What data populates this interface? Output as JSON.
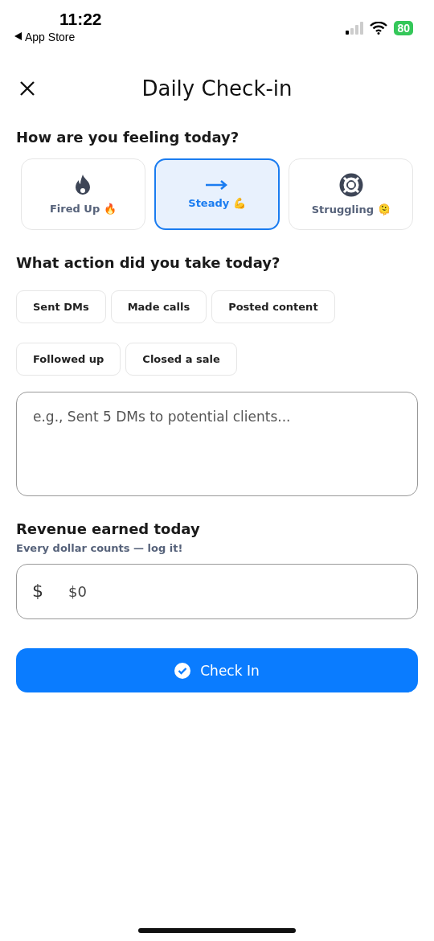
{
  "status_bar": {
    "time": "11:22",
    "back_label": "App Store",
    "battery": "80"
  },
  "header": {
    "title": "Daily Check-in"
  },
  "mood": {
    "question": "How are you feeling today?",
    "options": [
      {
        "kind": "fire",
        "label": "Fired Up 🔥",
        "selected": false
      },
      {
        "kind": "arrow",
        "label": "Steady 💪",
        "selected": true
      },
      {
        "kind": "lifebuoy",
        "label": "Struggling 🫠",
        "selected": false
      }
    ]
  },
  "actions": {
    "question": "What action did you take today?",
    "rows": [
      [
        {
          "label": "Sent DMs",
          "selected": false
        },
        {
          "label": "Made calls",
          "selected": false
        },
        {
          "label": "Posted content",
          "selected": false
        }
      ],
      [
        {
          "label": "Followed up",
          "selected": false
        },
        {
          "label": "Closed a sale",
          "selected": false
        }
      ]
    ],
    "notes": {
      "placeholder": "e.g., Sent 5 DMs to potential clients..."
    }
  },
  "revenue": {
    "title": "Revenue earned today",
    "subtitle": "Every dollar counts — log it!",
    "currency": "$",
    "placeholder": "$0"
  },
  "submit": {
    "label": "Check In"
  }
}
